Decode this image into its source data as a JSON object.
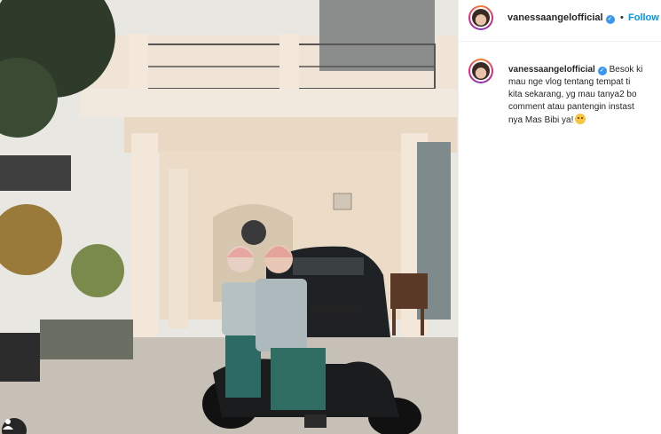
{
  "post": {
    "username": "vanessaangelofficial",
    "verified_mark": "✓",
    "dot_separator": "•",
    "follow_label": "Follow"
  },
  "caption": {
    "username": "vanessaangelofficial",
    "lines": [
      "Besok ki",
      "mau nge vlog tentang tempat ti",
      "kita sekarang, yg mau tanya2 bo",
      "comment atau pantengin instast",
      "nya Mas Bibi ya!"
    ],
    "emoji": "kiss-emoji"
  },
  "photo": {
    "subject": "couple-on-scooter-photo"
  },
  "icons": {
    "tag": "user-tag-icon",
    "verified": "verified-badge-icon"
  },
  "colors": {
    "follow": "#0095f6",
    "verified": "#3897f0",
    "text": "#262626"
  }
}
